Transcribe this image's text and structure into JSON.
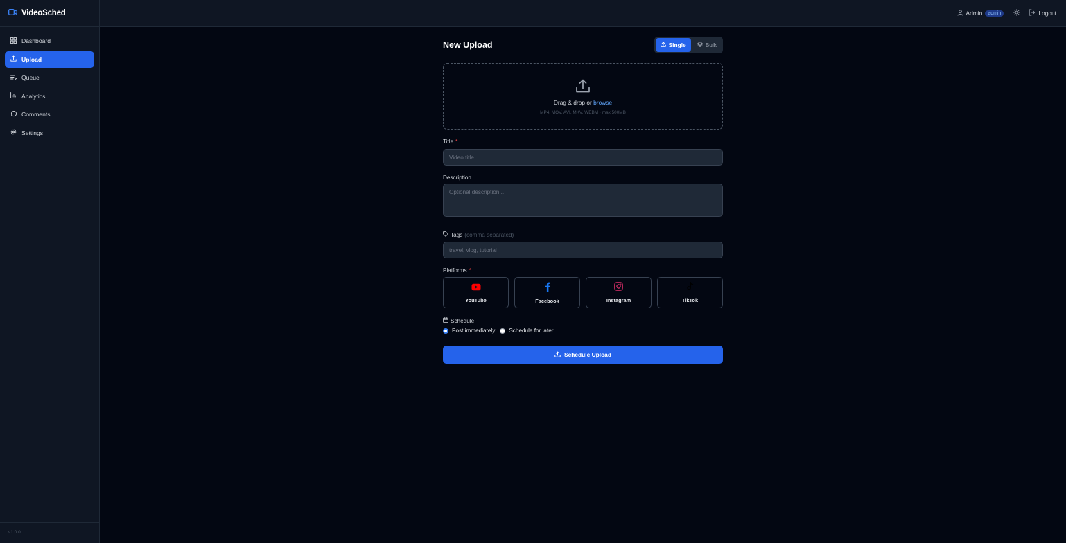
{
  "app": {
    "name": "VideoSched",
    "version": "v1.0.0",
    "accent": "#2563eb"
  },
  "sidebar": {
    "items": [
      {
        "label": "Dashboard",
        "icon": "dashboard-icon",
        "active": false
      },
      {
        "label": "Upload",
        "icon": "upload-icon",
        "active": true
      },
      {
        "label": "Queue",
        "icon": "queue-icon",
        "active": false
      },
      {
        "label": "Analytics",
        "icon": "bar-chart-icon",
        "active": false
      },
      {
        "label": "Comments",
        "icon": "comment-icon",
        "active": false
      },
      {
        "label": "Settings",
        "icon": "gear-icon",
        "active": false
      }
    ]
  },
  "topbar": {
    "user": "Admin",
    "role_badge": "admin",
    "logout_label": "Logout"
  },
  "page": {
    "title": "New Upload",
    "mode": {
      "single": "Single",
      "bulk": "Bulk",
      "selected": "Single"
    },
    "dropzone": {
      "text": "Drag & drop or ",
      "browse": "browse",
      "hint": "MP4, MOV, AVI, MKV, WEBM · max 500MB"
    },
    "form": {
      "title_label": "Title",
      "title_placeholder": "Video title",
      "title_value": "",
      "description_label": "Description",
      "description_placeholder": "Optional description...",
      "description_value": "",
      "tags_label": "Tags",
      "tags_hint": "(comma separated)",
      "tags_placeholder": "travel, vlog, tutorial",
      "tags_value": "",
      "required_mark": "*"
    },
    "platforms": {
      "label": "Platforms",
      "items": [
        {
          "name": "YouTube",
          "icon": "youtube-icon",
          "color": "#ff0000"
        },
        {
          "name": "Facebook",
          "icon": "facebook-icon",
          "color": "#1877f2"
        },
        {
          "name": "Instagram",
          "icon": "instagram-icon",
          "color": "#e1306c"
        },
        {
          "name": "TikTok",
          "icon": "tiktok-icon",
          "color": "#000000"
        }
      ]
    },
    "schedule": {
      "label": "Schedule",
      "options": [
        "Post immediately",
        "Schedule for later"
      ],
      "selected": "Post immediately"
    },
    "submit_label": "Schedule Upload"
  }
}
